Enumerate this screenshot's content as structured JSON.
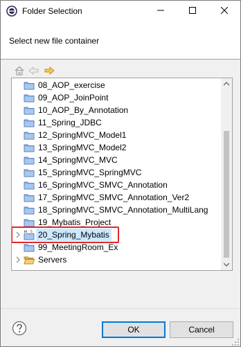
{
  "window": {
    "title": "Folder Selection",
    "icon": "eclipse-icon"
  },
  "header": {
    "message": "Select new file container"
  },
  "toolbar": {
    "icons": [
      "home-icon",
      "back-icon",
      "forward-icon"
    ]
  },
  "tree": {
    "items": [
      {
        "label": "08_AOP_exercise",
        "icon": "folder-icon",
        "expandable": false
      },
      {
        "label": "09_AOP_JoinPoint",
        "icon": "folder-icon",
        "expandable": false
      },
      {
        "label": "10_AOP_By_Annotation",
        "icon": "folder-icon",
        "expandable": false
      },
      {
        "label": "11_Spring_JDBC",
        "icon": "folder-icon",
        "expandable": false
      },
      {
        "label": "12_SpringMVC_Model1",
        "icon": "folder-icon",
        "expandable": false
      },
      {
        "label": "13_SpringMVC_Model2",
        "icon": "folder-icon",
        "expandable": false
      },
      {
        "label": "14_SpringMVC_MVC",
        "icon": "folder-icon",
        "expandable": false
      },
      {
        "label": "15_SpringMVC_SpringMVC",
        "icon": "folder-icon",
        "expandable": false
      },
      {
        "label": "16_SpringMVC_SMVC_Annotation",
        "icon": "folder-icon",
        "expandable": false
      },
      {
        "label": "17_SpringMVC_SMVC_Annotation_Ver2",
        "icon": "folder-icon",
        "expandable": false
      },
      {
        "label": "18_SpringMVC_SMVC_Annotation_MultiLang",
        "icon": "folder-icon",
        "expandable": false
      },
      {
        "label": "19_Mybatis_Project",
        "icon": "folder-icon",
        "expandable": false
      },
      {
        "label": "20_Spring_Mybatis",
        "icon": "maven-project-icon",
        "expandable": true,
        "selected": true
      },
      {
        "label": "99_MeetingRoom_Ex",
        "icon": "folder-icon",
        "expandable": false
      },
      {
        "label": "Servers",
        "icon": "open-folder-icon",
        "expandable": true
      }
    ]
  },
  "buttons": {
    "ok": "OK",
    "cancel": "Cancel"
  },
  "colors": {
    "selection": "#cce8ff",
    "highlight_border": "#e3242b",
    "default_button_border": "#0078d7"
  }
}
